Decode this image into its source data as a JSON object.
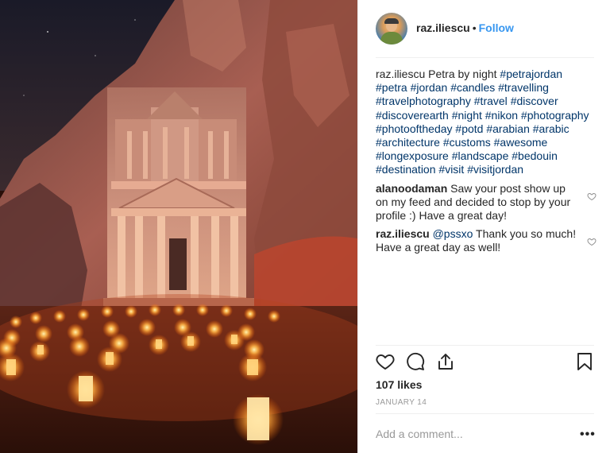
{
  "photo": {
    "alt": "Petra Treasury at night illuminated by candles",
    "icon": "photo"
  },
  "header": {
    "username": "raz.iliescu",
    "separator": "•",
    "follow_label": "Follow",
    "avatar_icon": "user-avatar"
  },
  "caption": {
    "username": "raz.iliescu",
    "text": "Petra by night",
    "hashtags": [
      "#petrajordan",
      "#petra",
      "#jordan",
      "#candles",
      "#travelling",
      "#travelphotography",
      "#travel",
      "#discover",
      "#discoverearth",
      "#night",
      "#nikon",
      "#photography",
      "#photooftheday",
      "#potd",
      "#arabian",
      "#arabic",
      "#architecture",
      "#customs",
      "#awesome",
      "#longexposure",
      "#landscape",
      "#bedouin",
      "#destination",
      "#visit",
      "#visitjordan"
    ]
  },
  "comments": [
    {
      "username": "alanoodaman",
      "text": "Saw your post show up on my feed and decided to stop by your profile :) Have a great day!",
      "like_icon": "heart-outline-icon"
    },
    {
      "username": "raz.iliescu",
      "mention": "@pssxo",
      "text": "Thank you so much! Have a great day as well!",
      "like_icon": "heart-outline-icon"
    }
  ],
  "actions": {
    "like_icon": "heart-icon",
    "comment_icon": "comment-icon",
    "share_icon": "share-icon",
    "save_icon": "bookmark-icon"
  },
  "likes_label": "107 likes",
  "date_label": "JANUARY 14",
  "add_comment": {
    "placeholder": "Add a comment...",
    "more_label": "•••"
  },
  "colors": {
    "link": "#3897f0",
    "hashtag": "#003569",
    "muted": "#999999",
    "text": "#262626",
    "border": "#efefef"
  }
}
